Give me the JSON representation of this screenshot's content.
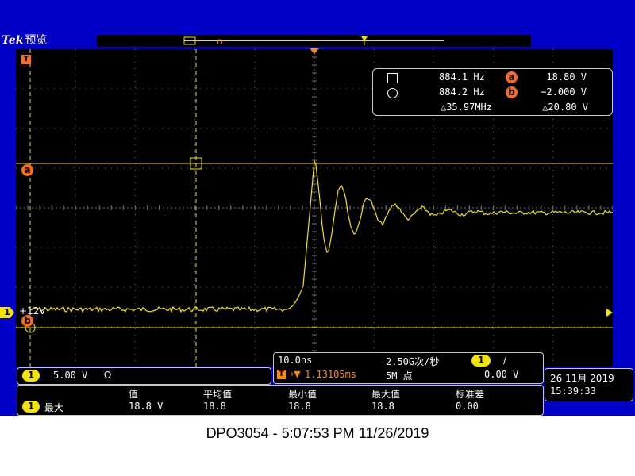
{
  "brand": {
    "logo": "Tek",
    "mode": "预览"
  },
  "cursors": {
    "a_marker": "a",
    "b_marker": "b",
    "row_a": {
      "shape": "square",
      "freq": "884.1 Hz",
      "tag": "a",
      "val": "18.80 V"
    },
    "row_b": {
      "shape": "circle",
      "freq": "884.2 Hz",
      "tag": "b",
      "val": "−2.000 V"
    },
    "delta_freq": "△35.97MHz",
    "delta_val": "△20.80 V"
  },
  "trigger": {
    "marker": "T",
    "label_left": "T"
  },
  "channel": {
    "number": "1",
    "ref_level_label": "+12V",
    "scale": "5.00 V",
    "coupling_icon": "Ω"
  },
  "horizontal": {
    "timebase": "10.0ns",
    "sample_rate": "2.50G次/秒",
    "trig_pos_icon": "T",
    "trig_pos_arrow": "→▼",
    "trig_pos": "1.13105ms",
    "record_length": "5M 点",
    "trig_ch": "1",
    "trig_slope": "/",
    "trig_level": "0.00 V"
  },
  "datetime": {
    "date": "26 11月  2019",
    "time": "15:39:33"
  },
  "measurements": {
    "headers": [
      "值",
      "平均值",
      "最小值",
      "最大值",
      "标准差"
    ],
    "row": {
      "ch": "1",
      "name": "最大",
      "values": [
        "18.8 V",
        "18.8",
        "18.8",
        "18.8",
        "0.00"
      ]
    }
  },
  "caption": "DPO3054 - 5:07:53 PM    11/26/2019",
  "colors": {
    "trace": "#f5e400",
    "cursor": "#f5e400",
    "grid": "#707070",
    "marker_orange": "#ff6a1a",
    "frame_blue": "#0000c8"
  }
}
